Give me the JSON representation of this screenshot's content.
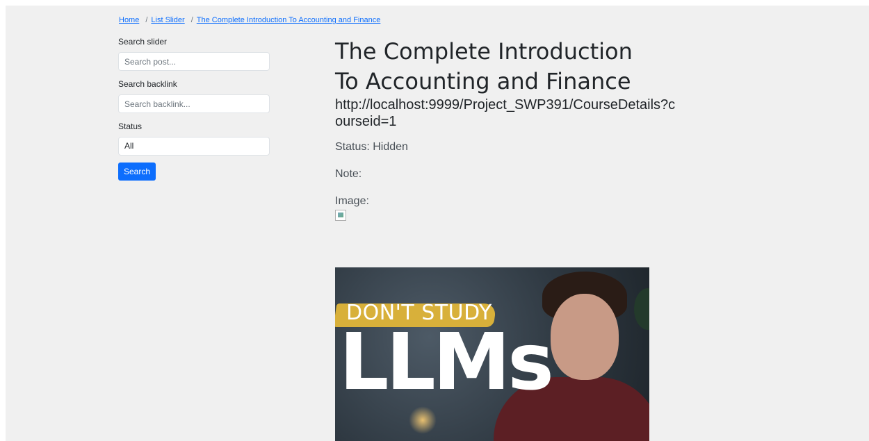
{
  "breadcrumb": {
    "home": "Home",
    "separator": "/",
    "list": "List Slider",
    "current": "The Complete Introduction To Accounting and Finance"
  },
  "sidebar": {
    "search_slider_label": "Search slider",
    "search_slider_placeholder": "Search post...",
    "search_backlink_label": "Search backlink",
    "search_backlink_placeholder": "Search backlink...",
    "status_label": "Status",
    "status_value": "All",
    "search_button": "Search"
  },
  "detail": {
    "title": "The Complete Introduction To Accounting and Finance",
    "backlink": "http://localhost:9999/Project_SWP391/CourseDetails?courseid=1",
    "status": "Status: Hidden",
    "note": "Note:",
    "image_label": "Image:"
  },
  "thumbnail": {
    "kicker": "DON'T STUDY",
    "headline": "LLMs"
  },
  "colors": {
    "primary": "#0d6efd",
    "page_background": "#f0f0f0",
    "brush_yellow": "#d8b03a"
  }
}
